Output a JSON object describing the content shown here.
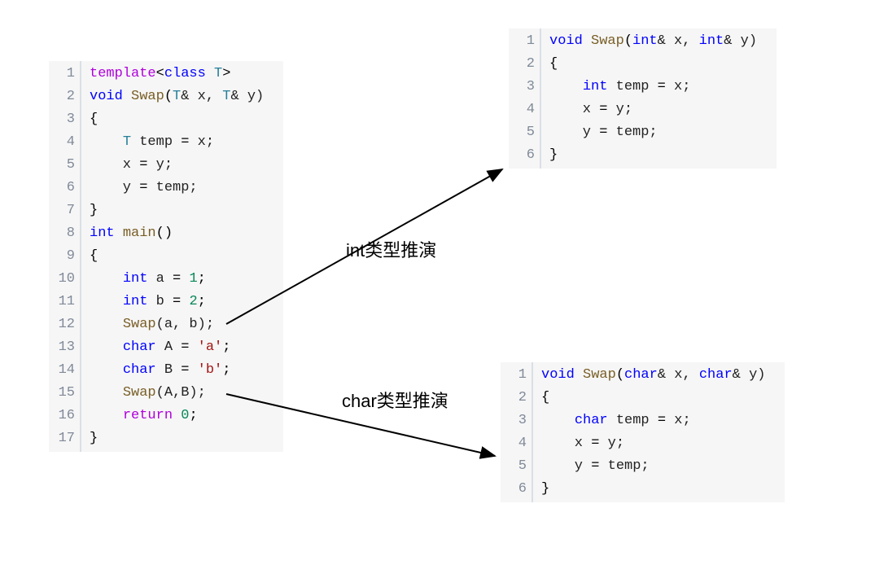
{
  "blocks": {
    "main": {
      "lines": [
        [
          {
            "t": "template",
            "c": "tmpl"
          },
          {
            "t": "<",
            "c": "op"
          },
          {
            "t": "class",
            "c": "kw-blue"
          },
          {
            "t": " ",
            "c": "txt"
          },
          {
            "t": "T",
            "c": "kw-type"
          },
          {
            "t": ">",
            "c": "op"
          }
        ],
        [
          {
            "t": "void",
            "c": "kw-blue"
          },
          {
            "t": " ",
            "c": "txt"
          },
          {
            "t": "Swap",
            "c": "fn-name"
          },
          {
            "t": "(",
            "c": "op"
          },
          {
            "t": "T",
            "c": "kw-type"
          },
          {
            "t": "& x, ",
            "c": "txt"
          },
          {
            "t": "T",
            "c": "kw-type"
          },
          {
            "t": "& y)",
            "c": "txt"
          }
        ],
        [
          {
            "t": "{",
            "c": "op"
          }
        ],
        [
          {
            "t": "    ",
            "c": "txt"
          },
          {
            "t": "T",
            "c": "kw-type"
          },
          {
            "t": " temp ",
            "c": "txt"
          },
          {
            "t": "=",
            "c": "op"
          },
          {
            "t": " x;",
            "c": "txt"
          }
        ],
        [
          {
            "t": "    x ",
            "c": "txt"
          },
          {
            "t": "=",
            "c": "op"
          },
          {
            "t": " y;",
            "c": "txt"
          }
        ],
        [
          {
            "t": "    y ",
            "c": "txt"
          },
          {
            "t": "=",
            "c": "op"
          },
          {
            "t": " temp;",
            "c": "txt"
          }
        ],
        [
          {
            "t": "}",
            "c": "op"
          }
        ],
        [
          {
            "t": "int",
            "c": "kw-blue"
          },
          {
            "t": " ",
            "c": "txt"
          },
          {
            "t": "main",
            "c": "fn-name"
          },
          {
            "t": "()",
            "c": "op"
          }
        ],
        [
          {
            "t": "{",
            "c": "op"
          }
        ],
        [
          {
            "t": "    ",
            "c": "txt"
          },
          {
            "t": "int",
            "c": "kw-blue"
          },
          {
            "t": " a ",
            "c": "txt"
          },
          {
            "t": "=",
            "c": "op"
          },
          {
            "t": " ",
            "c": "txt"
          },
          {
            "t": "1",
            "c": "num"
          },
          {
            "t": ";",
            "c": "op"
          }
        ],
        [
          {
            "t": "    ",
            "c": "txt"
          },
          {
            "t": "int",
            "c": "kw-blue"
          },
          {
            "t": " b ",
            "c": "txt"
          },
          {
            "t": "=",
            "c": "op"
          },
          {
            "t": " ",
            "c": "txt"
          },
          {
            "t": "2",
            "c": "num"
          },
          {
            "t": ";",
            "c": "op"
          }
        ],
        [
          {
            "t": "    ",
            "c": "txt"
          },
          {
            "t": "Swap",
            "c": "fn-name"
          },
          {
            "t": "(a, b);",
            "c": "txt"
          }
        ],
        [
          {
            "t": "    ",
            "c": "txt"
          },
          {
            "t": "char",
            "c": "kw-blue"
          },
          {
            "t": " A ",
            "c": "txt"
          },
          {
            "t": "=",
            "c": "op"
          },
          {
            "t": " ",
            "c": "txt"
          },
          {
            "t": "'a'",
            "c": "str"
          },
          {
            "t": ";",
            "c": "op"
          }
        ],
        [
          {
            "t": "    ",
            "c": "txt"
          },
          {
            "t": "char",
            "c": "kw-blue"
          },
          {
            "t": " B ",
            "c": "txt"
          },
          {
            "t": "=",
            "c": "op"
          },
          {
            "t": " ",
            "c": "txt"
          },
          {
            "t": "'b'",
            "c": "str"
          },
          {
            "t": ";",
            "c": "op"
          }
        ],
        [
          {
            "t": "    ",
            "c": "txt"
          },
          {
            "t": "Swap",
            "c": "fn-name"
          },
          {
            "t": "(A,B);",
            "c": "txt"
          }
        ],
        [
          {
            "t": "    ",
            "c": "txt"
          },
          {
            "t": "return",
            "c": "tmpl"
          },
          {
            "t": " ",
            "c": "txt"
          },
          {
            "t": "0",
            "c": "num"
          },
          {
            "t": ";",
            "c": "op"
          }
        ],
        [
          {
            "t": "}",
            "c": "op"
          }
        ]
      ]
    },
    "intblk": {
      "lines": [
        [
          {
            "t": "void",
            "c": "kw-blue"
          },
          {
            "t": " ",
            "c": "txt"
          },
          {
            "t": "Swap",
            "c": "fn-name"
          },
          {
            "t": "(",
            "c": "op"
          },
          {
            "t": "int",
            "c": "kw-blue"
          },
          {
            "t": "& x, ",
            "c": "txt"
          },
          {
            "t": "int",
            "c": "kw-blue"
          },
          {
            "t": "& y)",
            "c": "txt"
          }
        ],
        [
          {
            "t": "{",
            "c": "op"
          }
        ],
        [
          {
            "t": "    ",
            "c": "txt"
          },
          {
            "t": "int",
            "c": "kw-blue"
          },
          {
            "t": " temp ",
            "c": "txt"
          },
          {
            "t": "=",
            "c": "op"
          },
          {
            "t": " x;",
            "c": "txt"
          }
        ],
        [
          {
            "t": "    x ",
            "c": "txt"
          },
          {
            "t": "=",
            "c": "op"
          },
          {
            "t": " y;",
            "c": "txt"
          }
        ],
        [
          {
            "t": "    y ",
            "c": "txt"
          },
          {
            "t": "=",
            "c": "op"
          },
          {
            "t": " temp;",
            "c": "txt"
          }
        ],
        [
          {
            "t": "}",
            "c": "op"
          }
        ]
      ]
    },
    "charblk": {
      "lines": [
        [
          {
            "t": "void",
            "c": "kw-blue"
          },
          {
            "t": " ",
            "c": "txt"
          },
          {
            "t": "Swap",
            "c": "fn-name"
          },
          {
            "t": "(",
            "c": "op"
          },
          {
            "t": "char",
            "c": "kw-blue"
          },
          {
            "t": "& x, ",
            "c": "txt"
          },
          {
            "t": "char",
            "c": "kw-blue"
          },
          {
            "t": "& y)",
            "c": "txt"
          }
        ],
        [
          {
            "t": "{",
            "c": "op"
          }
        ],
        [
          {
            "t": "    ",
            "c": "txt"
          },
          {
            "t": "char",
            "c": "kw-blue"
          },
          {
            "t": " temp ",
            "c": "txt"
          },
          {
            "t": "=",
            "c": "op"
          },
          {
            "t": " x;",
            "c": "txt"
          }
        ],
        [
          {
            "t": "    x ",
            "c": "txt"
          },
          {
            "t": "=",
            "c": "op"
          },
          {
            "t": " y;",
            "c": "txt"
          }
        ],
        [
          {
            "t": "    y ",
            "c": "txt"
          },
          {
            "t": "=",
            "c": "op"
          },
          {
            "t": " temp;",
            "c": "txt"
          }
        ],
        [
          {
            "t": "}",
            "c": "op"
          }
        ]
      ]
    }
  },
  "labels": {
    "int_label": "int类型推演",
    "char_label": "char类型推演"
  }
}
